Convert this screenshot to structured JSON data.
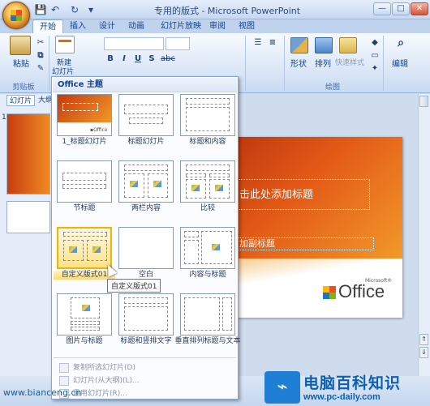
{
  "window": {
    "title": "专用的版式 - Microsoft PowerPoint"
  },
  "quick_access": {
    "save": "💾",
    "undo": "↶",
    "redo": "↻"
  },
  "window_controls": {
    "minimize": "—",
    "maximize": "□",
    "close": "✕"
  },
  "tabs": [
    {
      "label": "开始",
      "active": true
    },
    {
      "label": "插入"
    },
    {
      "label": "设计"
    },
    {
      "label": "动画"
    },
    {
      "label": "幻灯片放映"
    },
    {
      "label": "审阅"
    },
    {
      "label": "视图"
    }
  ],
  "ribbon": {
    "paste_label": "粘贴",
    "clipboard_label": "剪贴板",
    "new_slide_label_1": "新建",
    "new_slide_label_2": "幻灯片",
    "font_buttons": [
      "B",
      "I",
      "U",
      "S",
      "abc"
    ],
    "shapes_label": "形状",
    "arrange_label": "排列",
    "quick_styles_label": "快速样式",
    "drawing_label": "绘图",
    "edit_label": "编辑"
  },
  "left_pane": {
    "tab_slides": "幻灯片",
    "tab_outline": "大纲",
    "slide_number": "1"
  },
  "slide": {
    "title_placeholder": "击此处添加标题",
    "subtitle_placeholder": "加副标题",
    "logo_text": "Office",
    "logo_mark": "Microsoft®"
  },
  "gallery": {
    "header": "Office 主题",
    "layouts": [
      {
        "label": "1_标题幻灯片"
      },
      {
        "label": "标题幻灯片"
      },
      {
        "label": "标题和内容"
      },
      {
        "label": "节标题"
      },
      {
        "label": "两栏内容"
      },
      {
        "label": "比较"
      },
      {
        "label": "自定义版式01"
      },
      {
        "label": "空白"
      },
      {
        "label": "内容与标题"
      },
      {
        "label": "图片与标题"
      },
      {
        "label": "标题和竖排文字"
      },
      {
        "label": "垂直排列标题与文本"
      }
    ],
    "commands": [
      {
        "label": "复制所选幻灯片(D)"
      },
      {
        "label": "幻灯片(从大纲)(L)..."
      },
      {
        "label": "重用幻灯片(R)..."
      }
    ]
  },
  "tooltip": "自定义版式01",
  "watermarks": {
    "left": "www.bianceng.cn",
    "right_name": "电脑百科知识",
    "right_url": "www.pc-daily.com"
  }
}
